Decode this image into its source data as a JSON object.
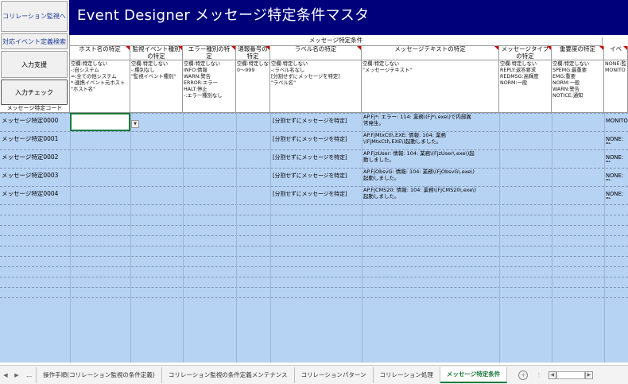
{
  "left_buttons": {
    "correlation": "コリレーション監視へ",
    "event_search": "対応イベント定義検索",
    "input_support": "入力支援",
    "input_check": "入力チェック"
  },
  "title": "Event Designer メッセージ特定条件マスタ",
  "headers": {
    "group": "メッセージ特定条件",
    "code_label": "メッセージ特定コード",
    "columns": [
      {
        "title": "ホスト名の特定",
        "note": "空欄:特定しない\n-:自システム\n=:全ての他システム\n*:連携イベント元ホスト\n\"ホスト名\""
      },
      {
        "title": "監視イベント種別\nの特定",
        "note": "空欄:特定しない\n-:種別なし\n\"監視イベント種別\""
      },
      {
        "title": "エラー種別の特\n定",
        "note": "空欄:特定しない\nINFO:情報\nWARN:警告\nERROR:エラー\nHALT:停止\n-:エラー種別なし"
      },
      {
        "title": "通報番号の\n特定",
        "note": "空欄:特定しない\n0〜999"
      },
      {
        "title": "ラベル名の特定",
        "note": "空欄:特定しない\n-:ラベル名なし\n[分割せずにメッセージを特定]\n\"ラベル名\""
      },
      {
        "title": "メッセージテキストの特定",
        "note": "空欄:特定しない\n\"メッセージテキスト\""
      },
      {
        "title": "メッセージタイプ\nの特定",
        "note": "空欄:特定しない\nREPLY:返答要求\nREDMSG:高輝度\nNORM:一般"
      },
      {
        "title": "重要度の特定",
        "note": "空欄:特定しない\nSPEMG:最重要\nEMG:重要\nNORM:一般\nWARN:警告\nNOTICE:通知"
      },
      {
        "title": "イベ",
        "note": "NONE:監\nMONITO"
      }
    ]
  },
  "rows": [
    {
      "code": "メッセージ特定0000",
      "label": "[分割せずにメッセージを特定]",
      "text": "AP.Fj*: エラー: 114: 業務\\(Fj*\\.exe\\)で内部異\n常発生。",
      "last": "MONITO"
    },
    {
      "code": "メッセージ特定0001",
      "label": "[分割せずにメッセージを特定]",
      "text": "AP.FjMtxCtl\\.EXE: 情報: 104: 業務\n\\(FjMtxCtl\\.EXE\\)起動しました。",
      "last": "NONE:監"
    },
    {
      "code": "メッセージ特定0002",
      "label": "[分割せずにメッセージを特定]",
      "text": "AP.FjzUser: 情報: 104: 業務\\(FjzUser\\.exe\\)起\n動しました。",
      "last": "NONE:監"
    },
    {
      "code": "メッセージ特定0003",
      "label": "[分割せずにメッセージを特定]",
      "text": "AP.FjObsvG: 情報: 104: 業務\\(FjObsvG\\.exe\\)\n起動しました。",
      "last": "NONE:監"
    },
    {
      "code": "メッセージ特定0004",
      "label": "[分割せずにメッセージを特定]",
      "text": "AP.FjCMS20: 情報: 104: 業務\\(FjCMS20\\.exe\\)\n起動しました。",
      "last": "NONE:監"
    }
  ],
  "tabs": {
    "ellipsis": "...",
    "items": [
      "操作手順(コリレーション監視の条件定義)",
      "コリレーション監視の条件定義メンテナンス",
      "コリレーションパターン",
      "コリレーション処理",
      "メッセージ特定条件"
    ],
    "active_index": 4
  },
  "colors": {
    "title_bg": "#00007a",
    "row_blue": "#b7d3f3",
    "selected_cell": "#ffffff",
    "active_tab": "#1a7a3c"
  }
}
